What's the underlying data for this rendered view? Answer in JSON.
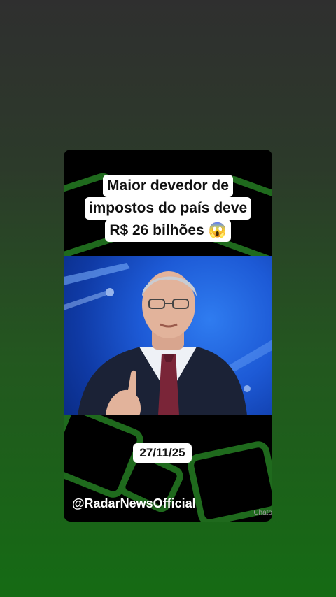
{
  "headline": {
    "line1": "Maior devedor de",
    "line2": "impostos do país deve",
    "line3": "R$ 26 bilhões 😱"
  },
  "date": "27/11/25",
  "handle": "@RadarNewsOfficial",
  "watermark": "Chato",
  "colors": {
    "accent_green": "#2a7a22",
    "card_bg": "#000000",
    "video_blue": "#1d5ad6"
  }
}
